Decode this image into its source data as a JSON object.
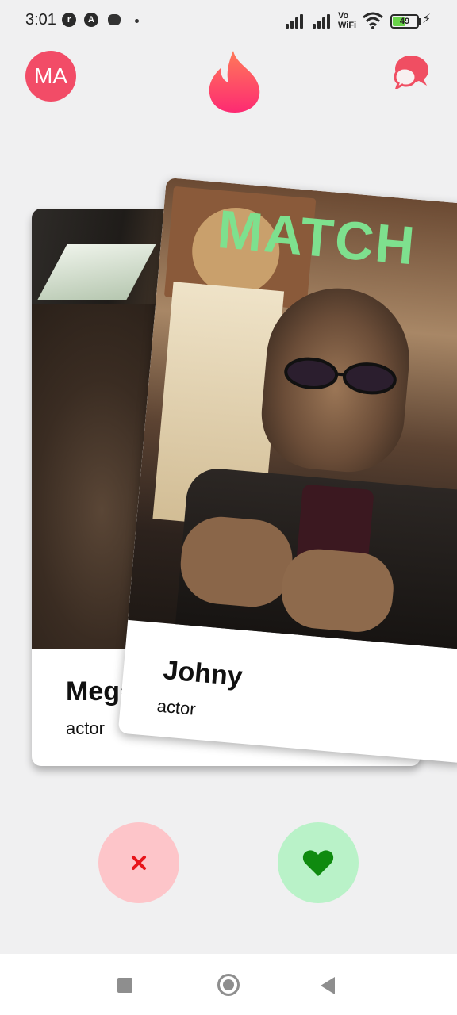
{
  "status_bar": {
    "time": "3:01",
    "icons": [
      "notification-r-icon",
      "notification-a-icon",
      "cat-icon",
      "dot-icon"
    ],
    "vowifi_top": "Vo",
    "vowifi_bottom": "WiFi",
    "battery_level": "49"
  },
  "header": {
    "avatar_initials": "MA",
    "logo_icon": "flame-icon",
    "chat_icon": "chat-bubbles-icon",
    "colors": {
      "avatar": "#f24c67",
      "flame_top": "#ff7a59",
      "flame_bottom": "#fd2a72"
    }
  },
  "cards": {
    "back": {
      "name": "Megan",
      "occupation": "actor"
    },
    "front": {
      "name": "Johny",
      "occupation": "actor",
      "overlay_label": "MATCH",
      "overlay_color": "#7ee08e"
    }
  },
  "actions": {
    "dislike": {
      "icon": "close-x-icon",
      "color": "#e8151b",
      "background": "#fdc5c9"
    },
    "like": {
      "icon": "heart-icon",
      "color": "#0f8a0f",
      "background": "#b9f2c8"
    }
  },
  "nav_bar": {
    "recents_icon": "square-icon",
    "home_icon": "circle-home-icon",
    "back_icon": "triangle-back-icon"
  }
}
